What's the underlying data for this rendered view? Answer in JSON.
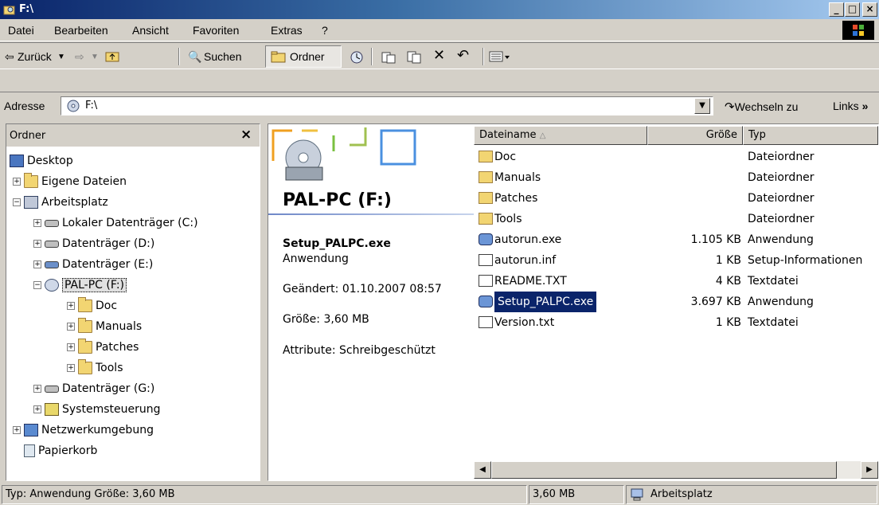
{
  "window": {
    "title": "F:\\"
  },
  "menu": [
    "Datei",
    "Bearbeiten",
    "Ansicht",
    "Favoriten",
    "Extras",
    "?"
  ],
  "toolbar": {
    "back": "Zurück",
    "search": "Suchen",
    "folders": "Ordner"
  },
  "address": {
    "label": "Adresse",
    "value": "F:\\",
    "go": "Wechseln zu",
    "links": "Links"
  },
  "folder_pane": {
    "title": "Ordner",
    "close": "×",
    "items": [
      "Desktop",
      "Eigene Dateien",
      "Arbeitsplatz",
      "Lokaler Datenträger (C:)",
      "Datenträger (D:)",
      "Datenträger (E:)",
      "PAL-PC (F:)",
      "Doc",
      "Manuals",
      "Patches",
      "Tools",
      "Datenträger (G:)",
      "Systemsteuerung",
      "Netzwerkumgebung",
      "Papierkorb"
    ]
  },
  "info": {
    "drive_title": "PAL-PC (F:)",
    "file_name": "Setup_PALPC.exe",
    "file_type": "Anwendung",
    "modified": "Geändert: 01.10.2007 08:57",
    "size": "Größe: 3,60 MB",
    "attributes": "Attribute: Schreibgeschützt"
  },
  "columns": {
    "name": "Dateiname",
    "size": "Größe",
    "type": "Typ"
  },
  "files": [
    {
      "name": "Doc",
      "size": "",
      "type": "Dateiordner"
    },
    {
      "name": "Manuals",
      "size": "",
      "type": "Dateiordner"
    },
    {
      "name": "Patches",
      "size": "",
      "type": "Dateiordner"
    },
    {
      "name": "Tools",
      "size": "",
      "type": "Dateiordner"
    },
    {
      "name": "autorun.exe",
      "size": "1.105 KB",
      "type": "Anwendung"
    },
    {
      "name": "autorun.inf",
      "size": "1 KB",
      "type": "Setup-Informationen"
    },
    {
      "name": "README.TXT",
      "size": "4 KB",
      "type": "Textdatei"
    },
    {
      "name": "Setup_PALPC.exe",
      "size": "3.697 KB",
      "type": "Anwendung"
    },
    {
      "name": "Version.txt",
      "size": "1 KB",
      "type": "Textdatei"
    }
  ],
  "statusbar": {
    "info": "Typ: Anwendung Größe: 3,60 MB",
    "size": "3,60 MB",
    "zone": "Arbeitsplatz"
  }
}
